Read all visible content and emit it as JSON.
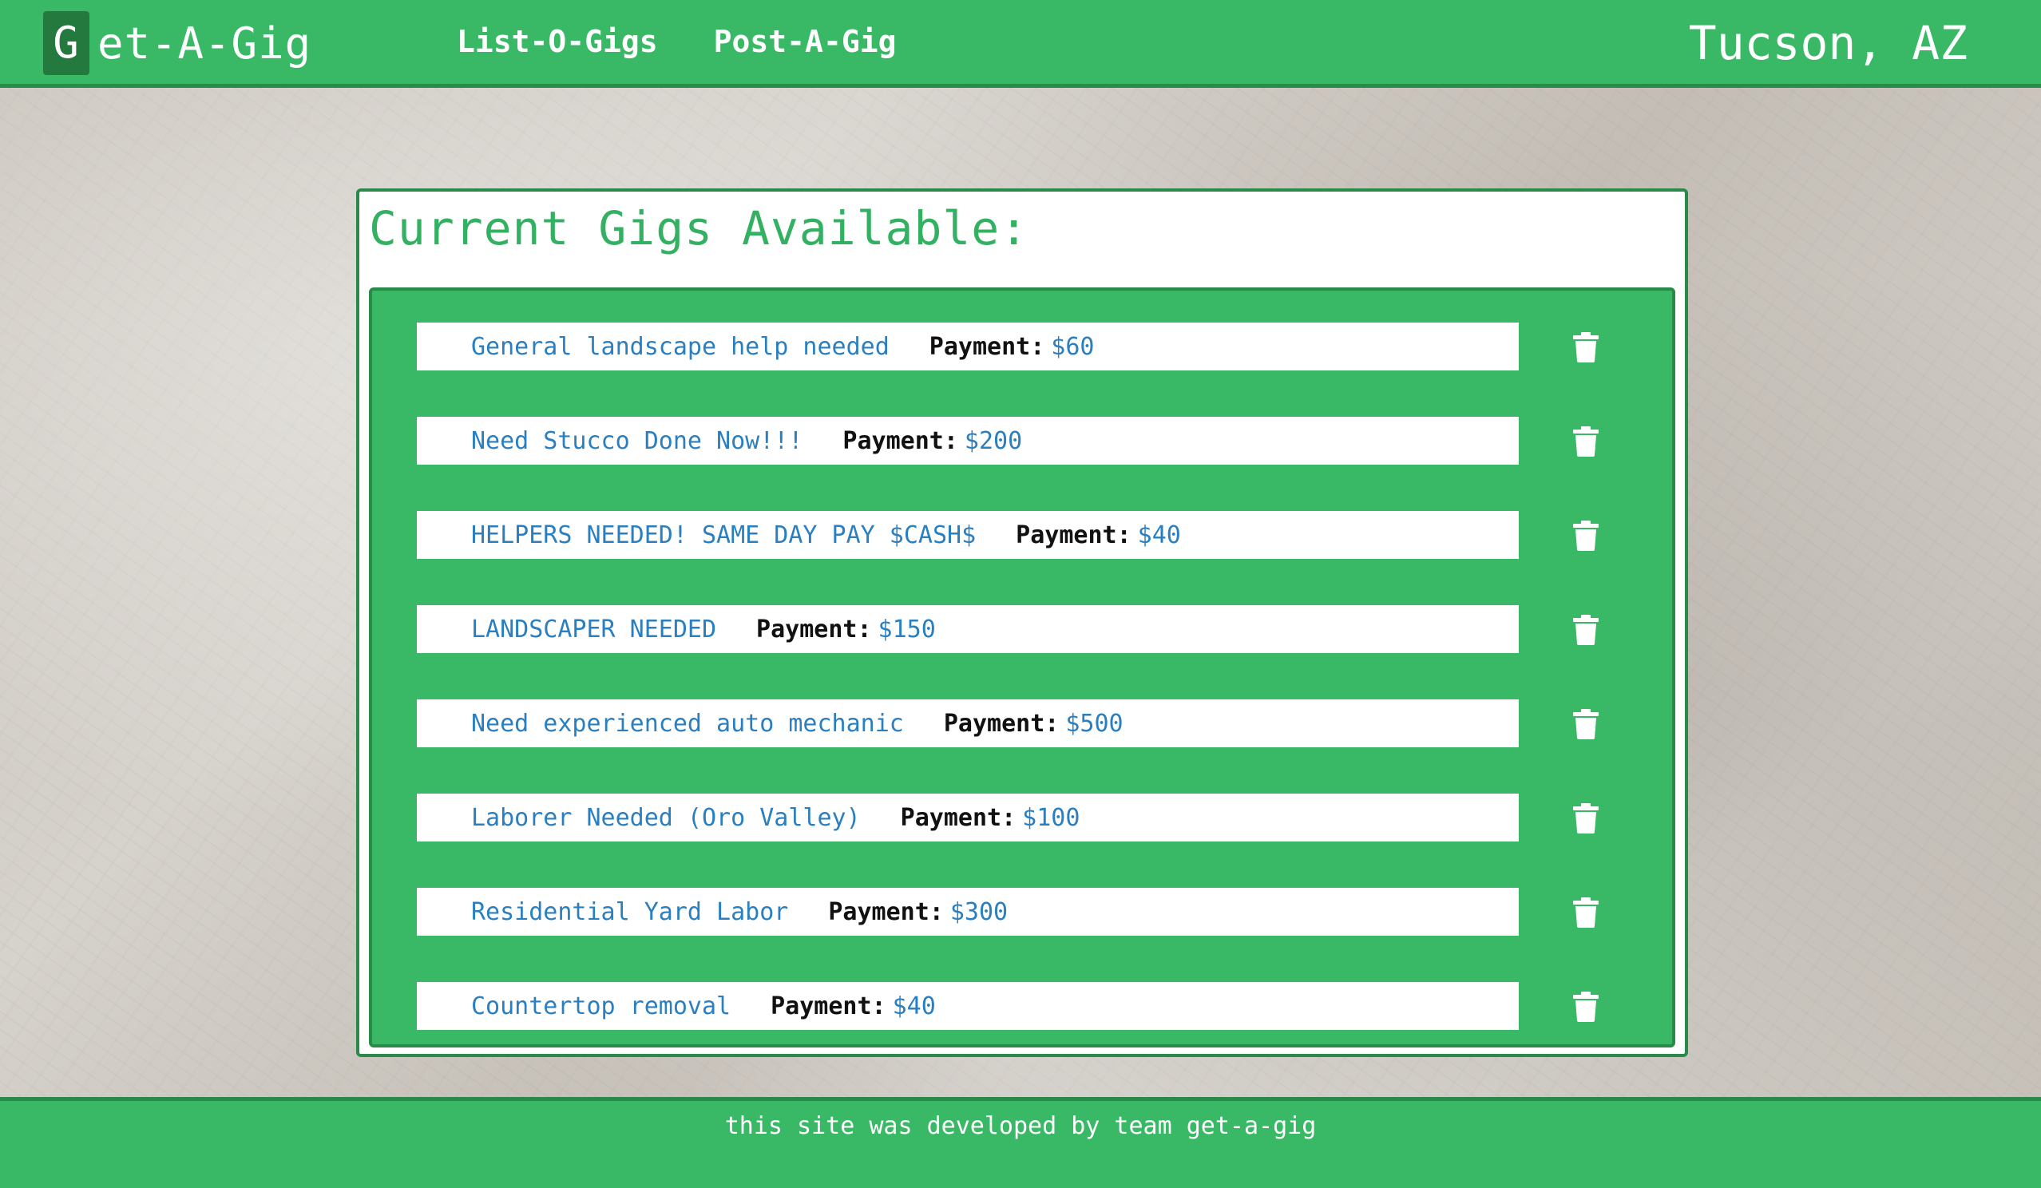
{
  "colors": {
    "brand_green": "#39b965",
    "dark_green": "#2a8a4a",
    "brand_box": "#24793f",
    "link_blue": "#2a7fc1",
    "title_green": "#33b061"
  },
  "header": {
    "brand_letter": "G",
    "brand_rest": "et-A-Gig",
    "nav": [
      {
        "label": "List-O-Gigs"
      },
      {
        "label": "Post-A-Gig"
      }
    ],
    "location": "Tucson, AZ"
  },
  "main": {
    "title": "Current Gigs Available:",
    "payment_label": "Payment:",
    "gigs": [
      {
        "title": "General landscape help needed",
        "payment": "$60",
        "icon": "trash-icon"
      },
      {
        "title": "Need Stucco Done Now!!!",
        "payment": "$200",
        "icon": "trash-icon"
      },
      {
        "title": "HELPERS NEEDED! SAME DAY PAY $CASH$",
        "payment": "$40",
        "icon": "trash-icon"
      },
      {
        "title": "LANDSCAPER NEEDED",
        "payment": "$150",
        "icon": "trash-icon"
      },
      {
        "title": "Need experienced auto mechanic",
        "payment": "$500",
        "icon": "trash-icon"
      },
      {
        "title": "Laborer Needed (Oro Valley)",
        "payment": "$100",
        "icon": "trash-icon"
      },
      {
        "title": "Residential Yard Labor",
        "payment": "$300",
        "icon": "trash-icon"
      },
      {
        "title": "Countertop removal",
        "payment": "$40",
        "icon": "trash-icon"
      }
    ]
  },
  "footer": {
    "text": "this site was developed by team get-a-gig"
  }
}
